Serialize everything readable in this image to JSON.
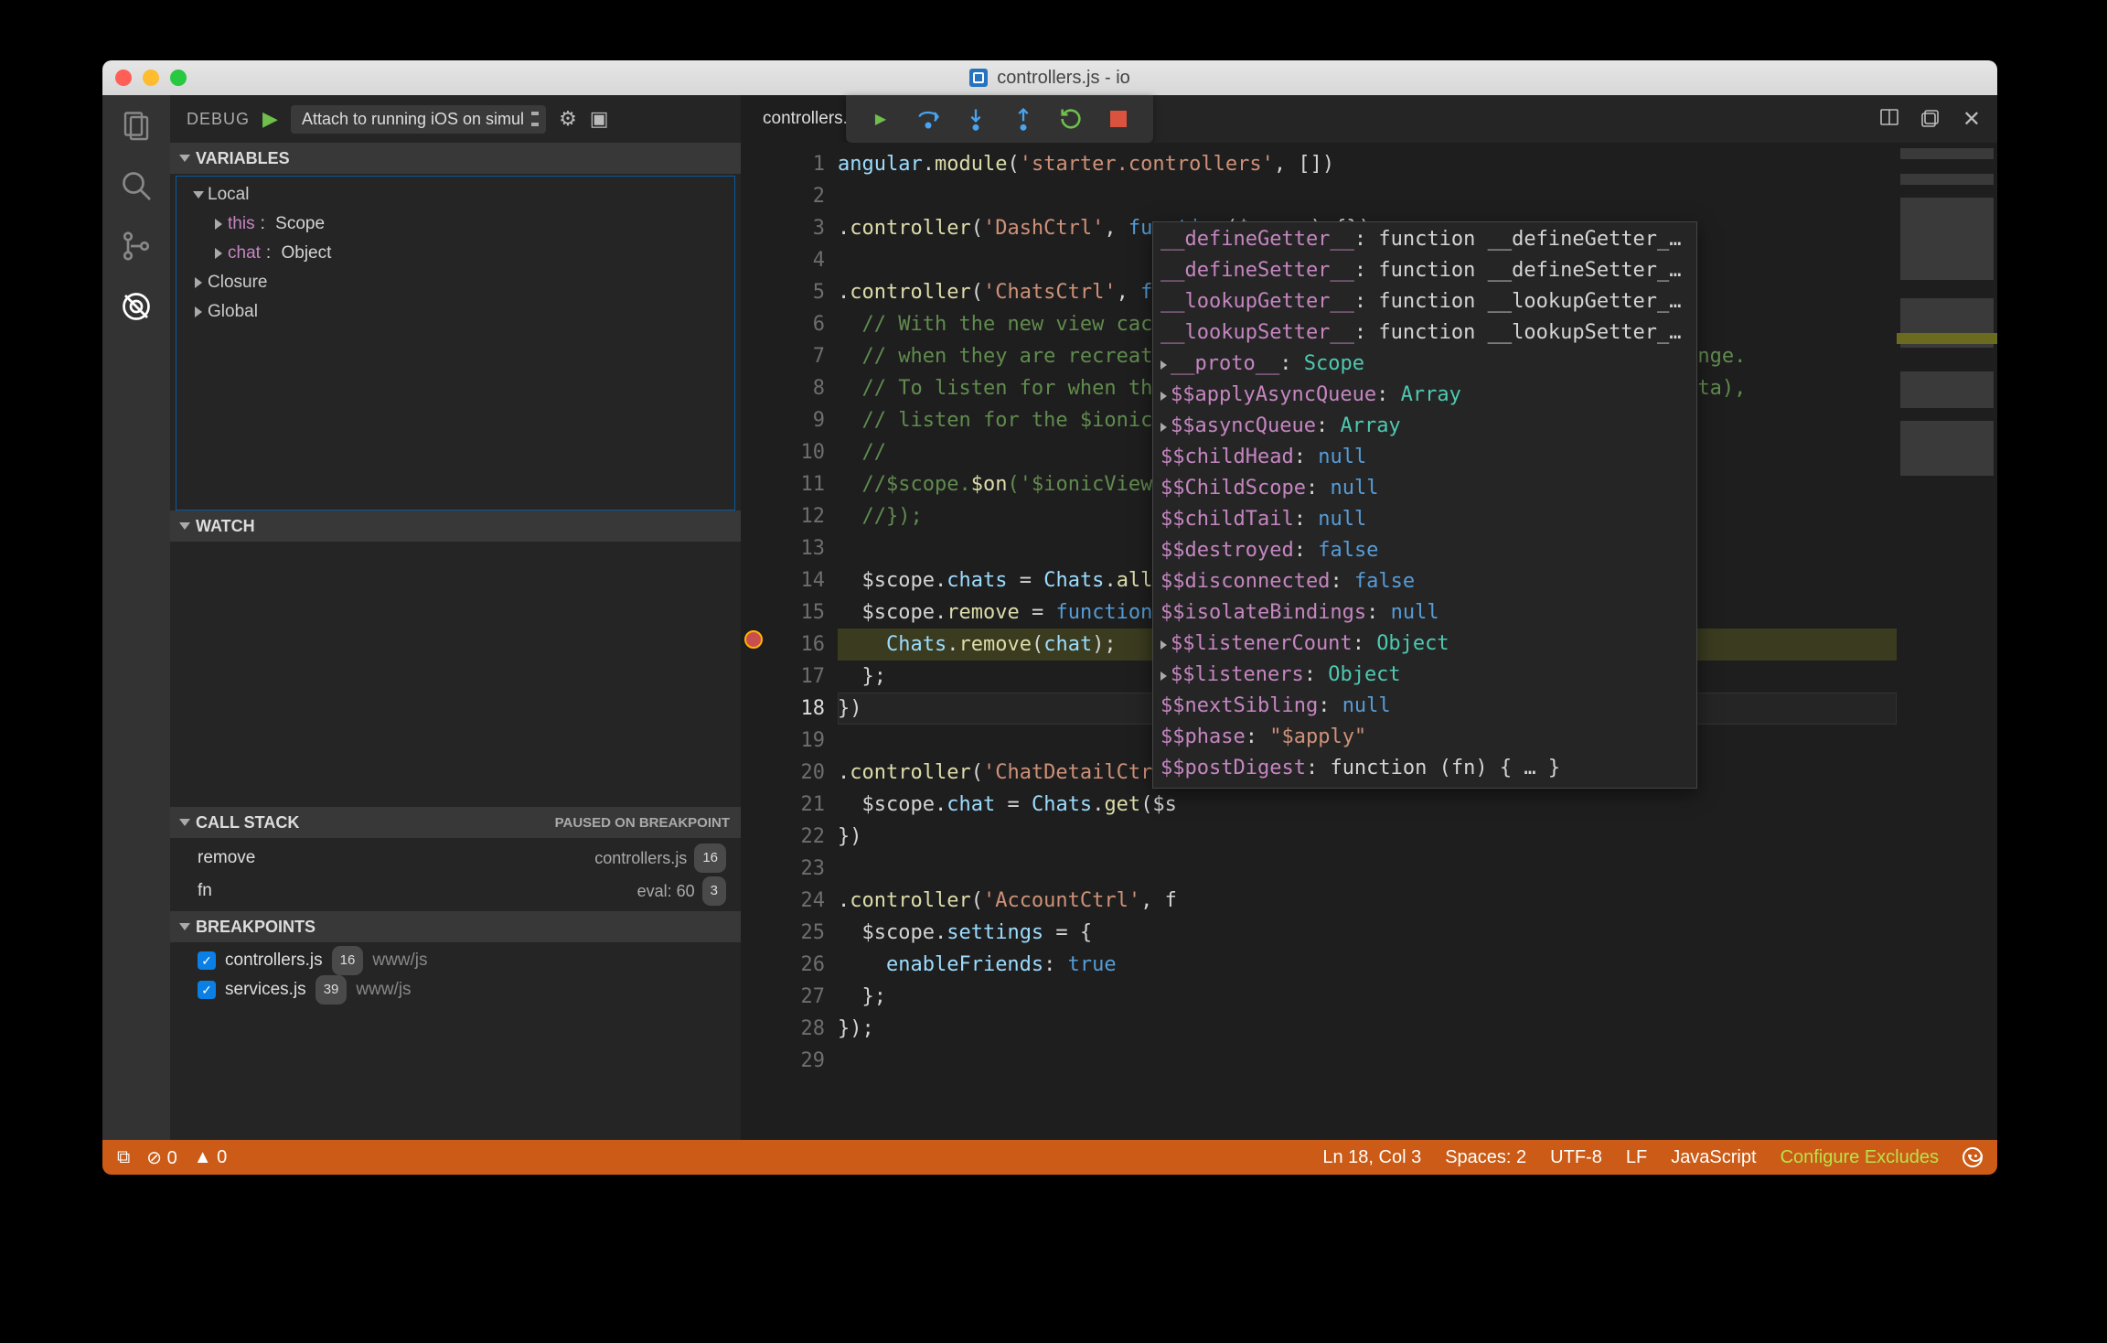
{
  "window": {
    "title": "controllers.js - io"
  },
  "activity_icons": [
    "files",
    "search",
    "git",
    "debug"
  ],
  "debug": {
    "title": "DEBUG",
    "config": "Attach to running iOS on simul",
    "sections": {
      "variables": "VARIABLES",
      "watch": "WATCH",
      "callstack": "CALL STACK",
      "callstack_status": "PAUSED ON BREAKPOINT",
      "breakpoints": "BREAKPOINTS"
    },
    "variables": {
      "local_label": "Local",
      "local": [
        {
          "key": "this",
          "value": "Scope"
        },
        {
          "key": "chat",
          "value": "Object"
        }
      ],
      "closure": "Closure",
      "global": "Global"
    },
    "callstack": [
      {
        "fn": "remove",
        "src": "controllers.js",
        "line": "16"
      },
      {
        "fn": "fn",
        "src": "eval: 60",
        "line": "3"
      }
    ],
    "breakpoints": [
      {
        "file": "controllers.js",
        "line": "16",
        "path": "www/js"
      },
      {
        "file": "services.js",
        "line": "39",
        "path": "www/js"
      }
    ]
  },
  "editor": {
    "tab": "controllers.js",
    "lines": [
      "angular.module('starter.controllers', [])",
      "",
      ".controller('DashCtrl', function($scope) {})",
      "",
      ".controller('ChatsCtrl', function($scope, Chats) {",
      "  // With the new view caching in Ionic, Controllers are only called",
      "  // when they are recreated or on app start, instead of every page change.",
      "  // To listen for when this page is active (for example, to refresh data),",
      "  // listen for the $ionicVi",
      "  //",
      "  //$scope.$on('$ionicView.e",
      "  //});",
      "",
      "  $scope.chats = Chats.all()",
      "  $scope.remove = function(c",
      "    Chats.remove(chat);",
      "  };",
      "})",
      "",
      ".controller('ChatDetailCtrl'",
      "  $scope.chat = Chats.get($s",
      "})",
      "",
      ".controller('AccountCtrl', f",
      "  $scope.settings = {",
      "    enableFriends: true",
      "  };",
      "});",
      ""
    ],
    "breakpoint_line": 16,
    "active_line": 18
  },
  "hover": [
    {
      "k": "__defineGetter__",
      "v": "function __defineGetter__() …"
    },
    {
      "k": "__defineSetter__",
      "v": "function __defineSetter__() …"
    },
    {
      "k": "__lookupGetter__",
      "v": "function __lookupGetter__() …"
    },
    {
      "k": "__lookupSetter__",
      "v": "function __lookupSetter__() …"
    },
    {
      "exp": true,
      "k": "__proto__",
      "v": "Scope"
    },
    {
      "exp": true,
      "k": "$$applyAsyncQueue",
      "v": "Array"
    },
    {
      "exp": true,
      "k": "$$asyncQueue",
      "v": "Array"
    },
    {
      "k": "$$childHead",
      "v": "null",
      "kw": true
    },
    {
      "k": "$$ChildScope",
      "v": "null",
      "kw": true
    },
    {
      "k": "$$childTail",
      "v": "null",
      "kw": true
    },
    {
      "k": "$$destroyed",
      "v": "false",
      "kw": true
    },
    {
      "k": "$$disconnected",
      "v": "false",
      "kw": true
    },
    {
      "k": "$$isolateBindings",
      "v": "null",
      "kw": true
    },
    {
      "exp": true,
      "k": "$$listenerCount",
      "v": "Object"
    },
    {
      "exp": true,
      "k": "$$listeners",
      "v": "Object"
    },
    {
      "k": "$$nextSibling",
      "v": "null",
      "kw": true
    },
    {
      "k": "$$phase",
      "v": "\"$apply\"",
      "str": true
    },
    {
      "k": "$$postDigest",
      "v": "function (fn) { … }"
    }
  ],
  "status": {
    "errors": "0",
    "warnings": "0",
    "position": "Ln 18, Col 3",
    "spaces": "Spaces: 2",
    "encoding": "UTF-8",
    "eol": "LF",
    "language": "JavaScript",
    "excludes": "Configure Excludes"
  }
}
